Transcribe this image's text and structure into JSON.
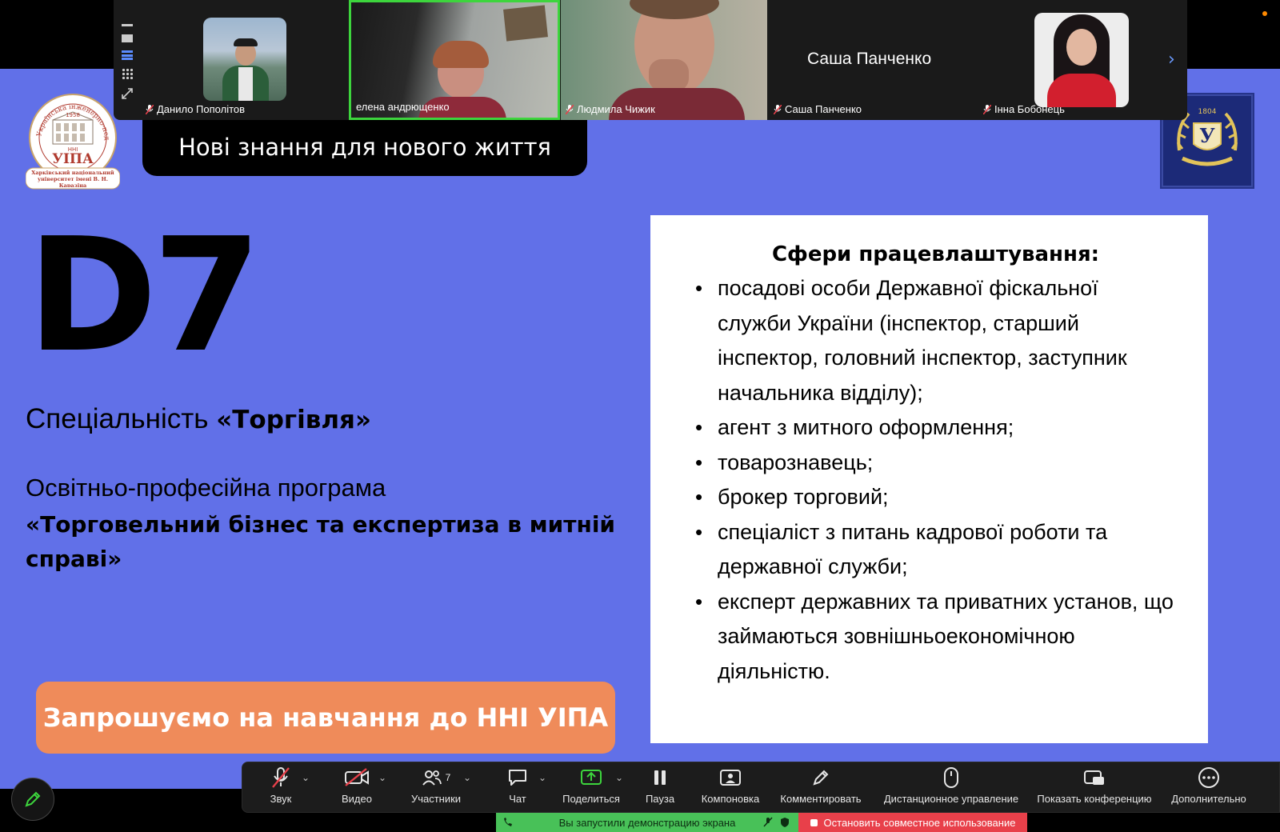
{
  "participants": [
    {
      "name": "Данило Пополітов",
      "muted": true
    },
    {
      "name": "елена андрющенко",
      "muted": false,
      "active": true
    },
    {
      "name": "Людмила Чижик",
      "muted": true
    },
    {
      "name": "Саша Панченко",
      "muted": true,
      "display_name": "Саша Панченко"
    },
    {
      "name": "Інна Бобонець",
      "muted": true
    }
  ],
  "slide": {
    "tagline": "Нові знання для нового життя",
    "left_logo": {
      "text_top": "Українська інженерно-педагогічна академія",
      "year": "1958",
      "abbr_small": "ННІ",
      "abbr": "УІПА",
      "caption": "Харківський національний університет імені В. Н. Каразіна"
    },
    "right_logo": {
      "year": "1804",
      "letter": "У"
    },
    "code": "D7",
    "spec_prefix": "Спеціальність ",
    "spec_name": "«Торгівля»",
    "program_label": "Освітньо-професійна програма",
    "program_name": "«Торговельний бізнес та експертиза в митній справі»",
    "cta": "Запрошуємо на навчання до ННІ УІПА",
    "jobs_title": "Сфери працевлаштування:",
    "jobs": [
      "посадові особи Державної фіскальної служби України (інспектор, старший інспектор, головний інспектор, заступник начальника відділу);",
      "агент з митного оформлення;",
      "товарознавець;",
      "брокер торговий;",
      "спеціаліст з питань кадрової роботи та державної служби;",
      "експерт державних та приватних установ, що займаються зовнішньоекономічною діяльністю."
    ]
  },
  "toolbar": {
    "audio": "Звук",
    "video": "Видео",
    "participants": "Участники",
    "participants_count": "7",
    "chat": "Чат",
    "share": "Поделиться",
    "pause": "Пауза",
    "layout": "Компоновка",
    "annotate": "Комментировать",
    "remote": "Дистанционное управление",
    "show_meeting": "Показать конференцию",
    "more": "Дополнительно"
  },
  "share_bar": {
    "status": "Вы запустили демонстрацию экрана",
    "stop": "Остановить совместное использование"
  },
  "colors": {
    "slide_bg": "#6170E8",
    "cta_bg": "#EF8B5A",
    "share_green": "#48C158",
    "stop_red": "#E8404A",
    "active_tile": "#3DD53D"
  }
}
